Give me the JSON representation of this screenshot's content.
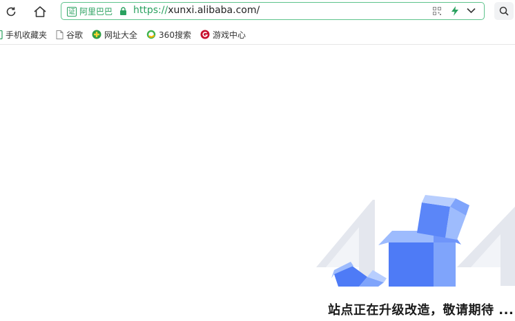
{
  "toolbar": {
    "refresh_icon": "refresh-icon",
    "home_icon": "home-icon"
  },
  "address_bar": {
    "cert_badge": "证",
    "cert_owner": "阿里巴巴",
    "url_scheme": "https://",
    "url_rest": "xunxi.alibaba.com/",
    "lock_icon": "lock-icon",
    "qr_icon": "qr-code-icon",
    "bolt_icon": "lightning-icon",
    "dropdown_icon": "chevron-down-icon",
    "accent_color": "#2aa15f"
  },
  "bookmarks": [
    {
      "label": "手机收藏夹",
      "icon": "phone-icon"
    },
    {
      "label": "谷歌",
      "icon": "page-icon"
    },
    {
      "label": "网址大全",
      "icon": "globe-icon"
    },
    {
      "label": "360搜索",
      "icon": "360-search-icon"
    },
    {
      "label": "游戏中心",
      "icon": "game-center-icon"
    }
  ],
  "page": {
    "message": "站点正在升级改造，敬请期待 ..."
  }
}
